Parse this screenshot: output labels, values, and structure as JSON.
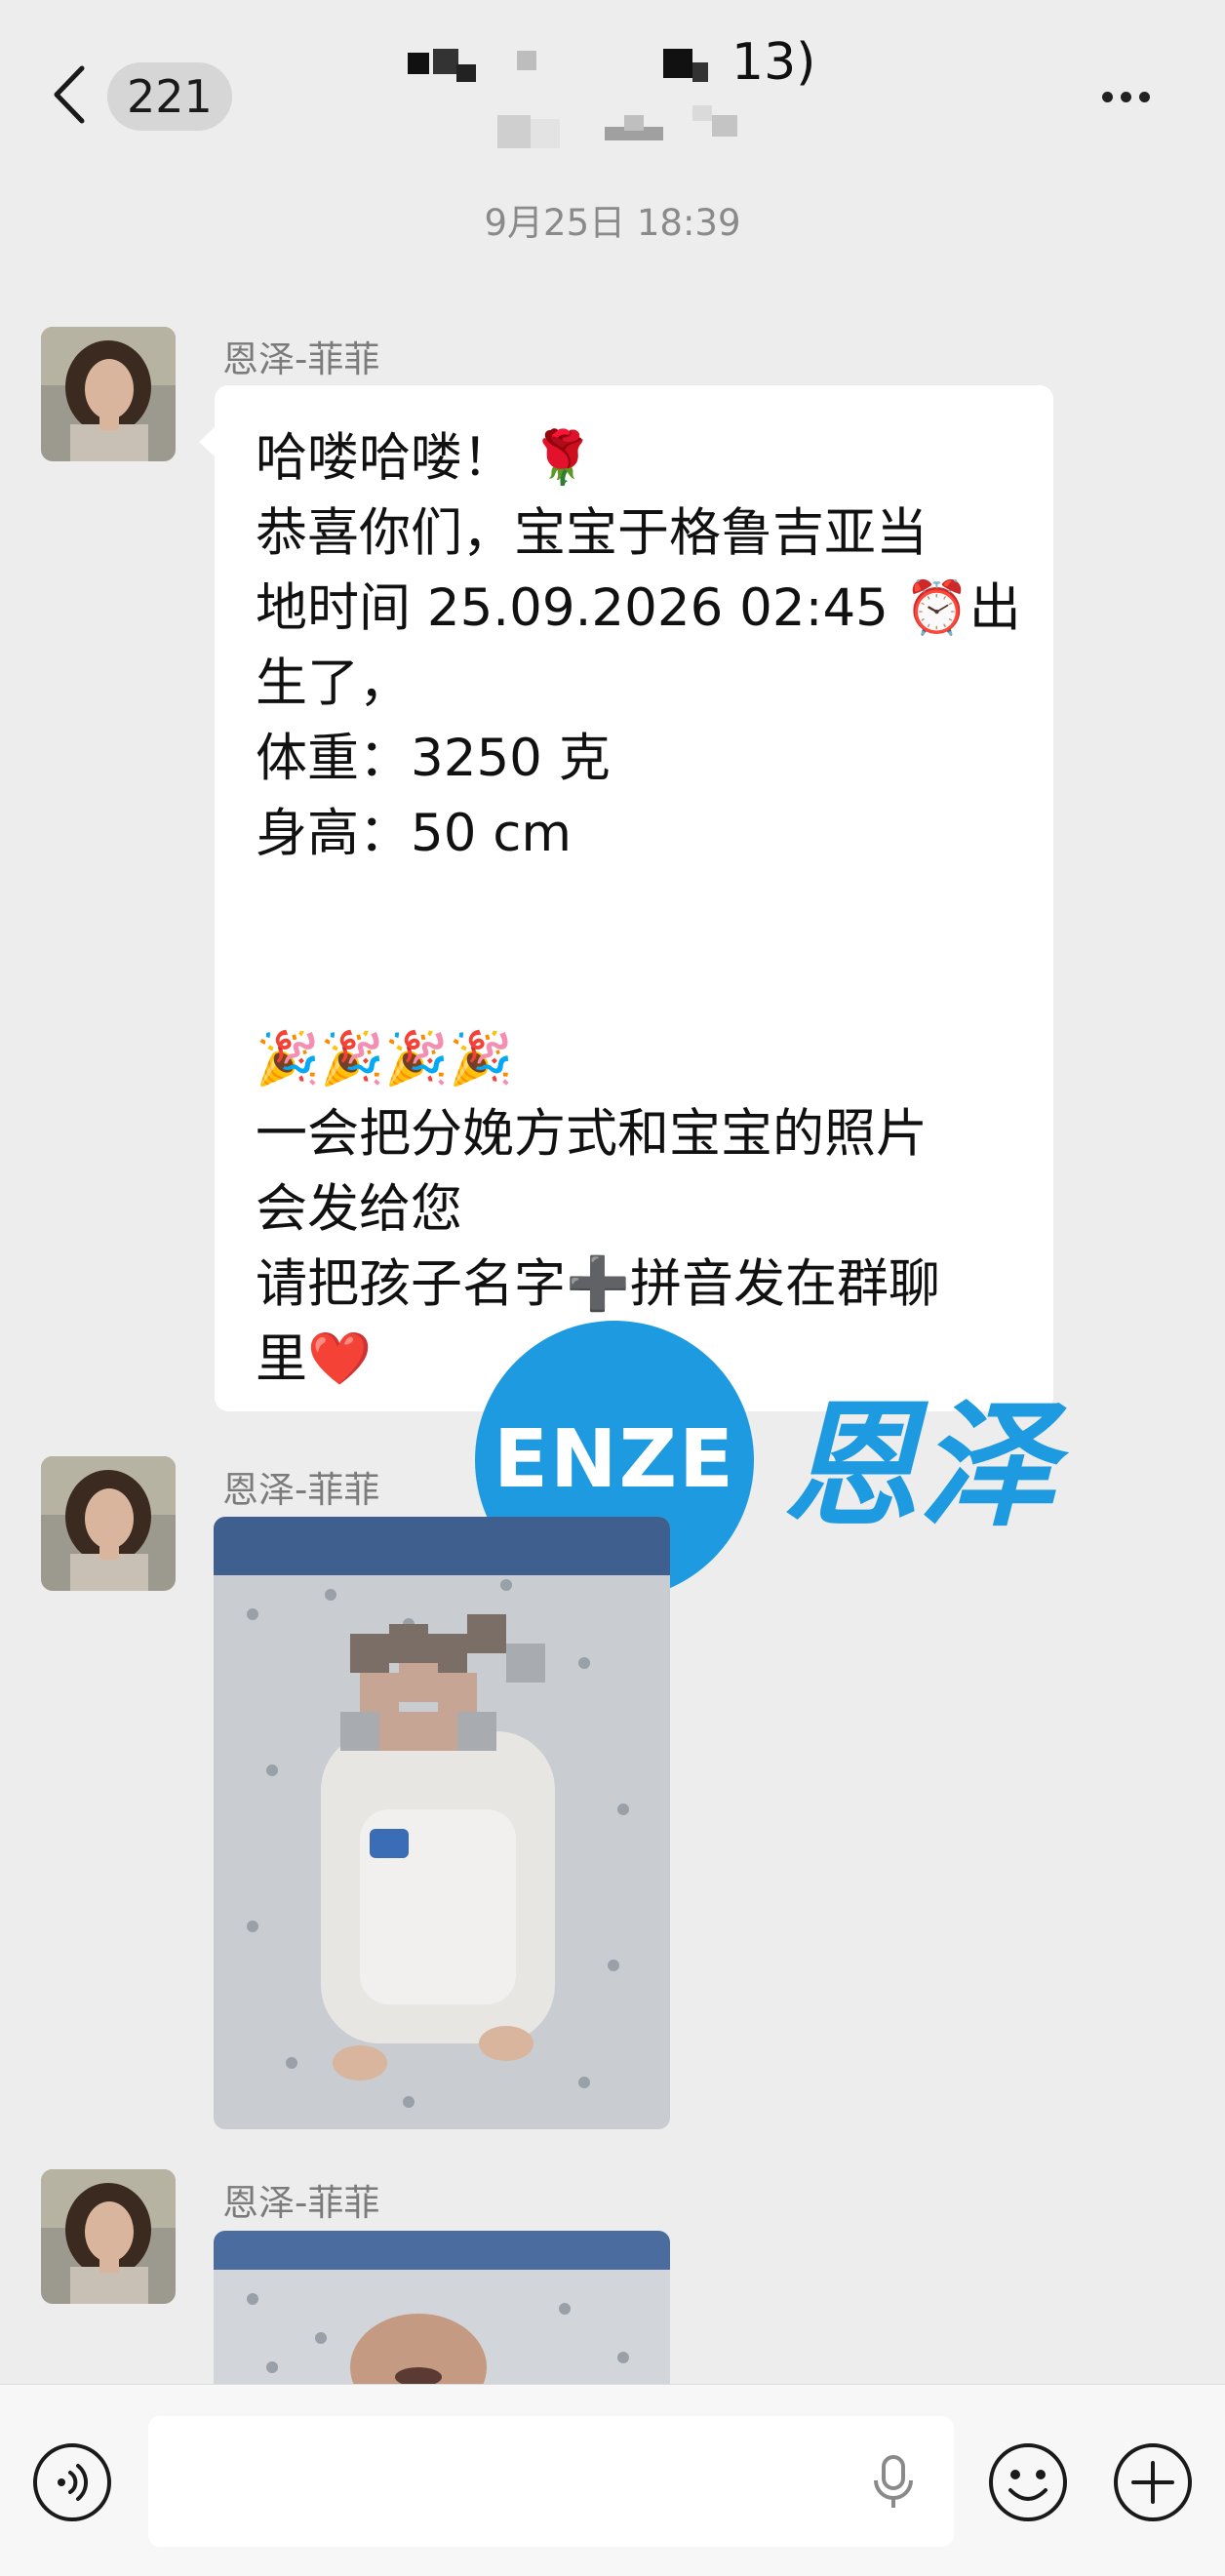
{
  "header": {
    "unread_count": "221",
    "title_suffix": "13)"
  },
  "timestamp": "9月25日 18:39",
  "messages": [
    {
      "sender": "恩泽-菲菲",
      "text": "哈喽哈喽！ 🌹\n恭喜你们，宝宝于格鲁吉亚当\n地时间 25.09.2026 02:45 ⏰出\n生了，\n体重：3250 克\n身高：50 cm\n\n\n🎉🎉🎉🎉\n一会把分娩方式和宝宝的照片\n会发给您\n请把孩子名字➕拼音发在群聊\n里❤️"
    },
    {
      "sender": "恩泽-菲菲",
      "type": "photo"
    },
    {
      "sender": "恩泽-菲菲",
      "type": "photo"
    }
  ],
  "watermark": {
    "logo_text": "ENZE",
    "chinese_text": "恩泽"
  },
  "input_bar": {
    "input_value": ""
  },
  "colors": {
    "background": "#ededed",
    "bubble": "#ffffff",
    "watermark_blue": "#1d9ae0",
    "badge": "#d6d6d6"
  },
  "icons": [
    "back-arrow-icon",
    "more-icon",
    "voice-icon",
    "microphone-icon",
    "emoji-icon",
    "plus-icon"
  ]
}
